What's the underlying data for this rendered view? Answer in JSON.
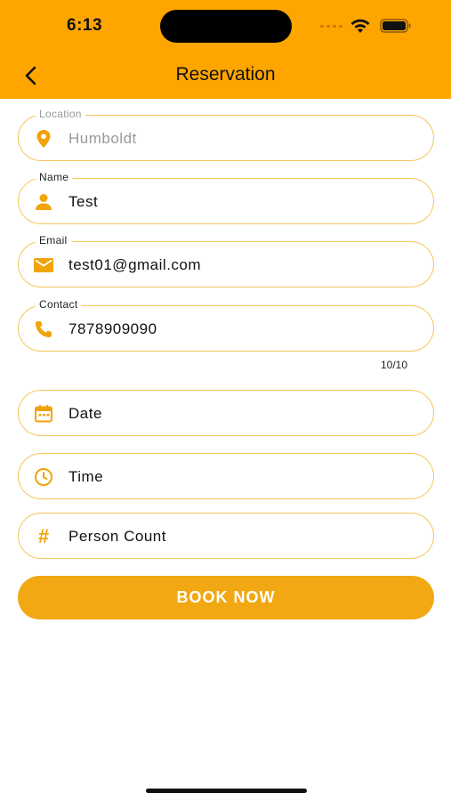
{
  "status_bar": {
    "time": "6:13"
  },
  "header": {
    "title": "Reservation",
    "back_icon": "chevron-left-icon"
  },
  "form": {
    "location": {
      "label": "Location",
      "value": "Humboldt",
      "icon": "location-pin-icon"
    },
    "name": {
      "label": "Name",
      "value": "Test",
      "icon": "person-icon"
    },
    "email": {
      "label": "Email",
      "value": "test01@gmail.com",
      "icon": "mail-icon"
    },
    "contact": {
      "label": "Contact",
      "value": "7878909090",
      "icon": "phone-icon",
      "counter": "10/10"
    },
    "date": {
      "placeholder": "Date",
      "icon": "calendar-icon"
    },
    "time": {
      "placeholder": "Time",
      "icon": "clock-icon"
    },
    "person_count": {
      "placeholder": "Person Count",
      "icon": "hash-icon"
    }
  },
  "book_button": {
    "label": "BOOK NOW"
  },
  "colors": {
    "header": "#FFA500",
    "accent": "#F0A30A",
    "field_border": "#F5C65A",
    "button": "#F2A812"
  }
}
